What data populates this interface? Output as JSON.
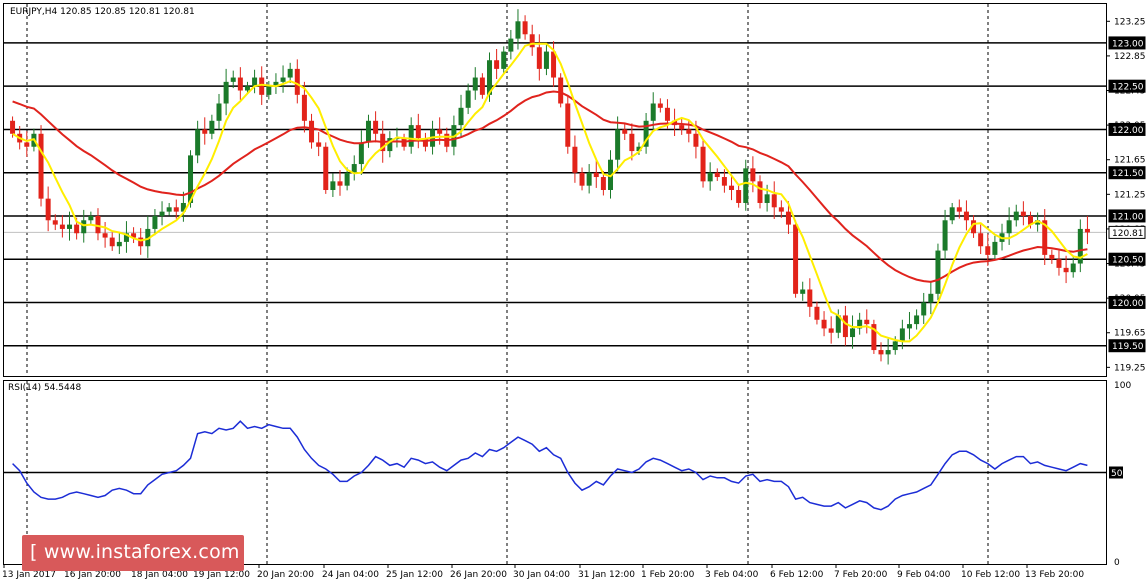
{
  "header": {
    "title": "EURJPY,H4  120.85 120.85 120.81 120.81"
  },
  "indicator": {
    "title": "RSI(14) 54.5448"
  },
  "watermark": {
    "text": "[ www.instaforex.com ]"
  },
  "colors": {
    "bull": "#1b7a2a",
    "bear": "#e2231a",
    "ma_fast": "#ffee00",
    "ma_slow": "#e0231d",
    "rsi": "#1c2dd6",
    "level_line": "#000000",
    "session_line": "#000000",
    "current_price": "#c0c0c0"
  },
  "chart_data": [
    {
      "type": "candlestick",
      "title": "EURJPY,H4  120.85 120.85 120.81 120.81",
      "ylim": [
        119.15,
        123.45
      ],
      "y_ticks": [
        "123.25",
        "122.85",
        "122.45",
        "122.05",
        "121.65",
        "121.25",
        "120.85",
        "120.45",
        "120.05",
        "119.65",
        "119.25"
      ],
      "level_labels": [
        "123.00",
        "122.50",
        "122.00",
        "121.50",
        "121.00",
        "120.81",
        "120.50",
        "120.00",
        "119.50"
      ],
      "levels": [
        123.0,
        122.5,
        122.0,
        121.5,
        121.0,
        120.5,
        120.0,
        119.5
      ],
      "current_price": 120.81,
      "x_labels": [
        "13 Jan 2017",
        "16 Jan 20:00",
        "18 Jan 04:00",
        "19 Jan 12:00",
        "20 Jan 20:00",
        "24 Jan 04:00",
        "25 Jan 12:00",
        "26 Jan 20:00",
        "30 Jan 04:00",
        "31 Jan 12:00",
        "1 Feb 20:00",
        "3 Feb 04:00",
        "6 Feb 12:00",
        "7 Feb 20:00",
        "9 Feb 04:00",
        "10 Feb 12:00",
        "13 Feb 20:00"
      ],
      "close": [
        121.95,
        121.85,
        121.8,
        121.95,
        121.2,
        120.95,
        120.9,
        120.85,
        120.9,
        120.8,
        120.95,
        121.0,
        120.8,
        120.75,
        120.65,
        120.7,
        120.8,
        120.75,
        120.65,
        120.85,
        121.0,
        121.05,
        121.1,
        121.05,
        121.15,
        121.7,
        122.0,
        121.95,
        122.1,
        122.3,
        122.55,
        122.6,
        122.45,
        122.5,
        122.6,
        122.4,
        122.5,
        122.55,
        122.6,
        122.7,
        122.4,
        122.1,
        121.85,
        121.8,
        121.3,
        121.4,
        121.35,
        121.5,
        121.6,
        121.85,
        122.1,
        121.95,
        121.75,
        121.9,
        121.9,
        121.8,
        122.05,
        121.9,
        121.8,
        122.0,
        121.95,
        121.8,
        122.05,
        122.25,
        122.45,
        122.6,
        122.4,
        122.8,
        122.7,
        122.9,
        123.05,
        123.25,
        123.1,
        122.95,
        122.7,
        122.9,
        122.6,
        122.3,
        121.8,
        121.5,
        121.35,
        121.5,
        121.45,
        121.3,
        121.65,
        122.0,
        121.95,
        121.75,
        121.8,
        122.1,
        122.3,
        122.25,
        122.1,
        122.05,
        122.0,
        121.95,
        121.8,
        121.4,
        121.5,
        121.45,
        121.35,
        121.3,
        121.15,
        121.55,
        121.4,
        121.15,
        121.25,
        121.1,
        121.05,
        120.9,
        120.1,
        120.15,
        119.95,
        119.8,
        119.7,
        119.65,
        119.85,
        119.6,
        119.7,
        119.8,
        119.75,
        119.45,
        119.4,
        119.45,
        119.55,
        119.7,
        119.75,
        119.85,
        120.0,
        120.1,
        120.6,
        120.95,
        121.1,
        121.05,
        120.95,
        120.8,
        120.65,
        120.55,
        120.7,
        120.8,
        120.95,
        121.05,
        121.0,
        120.9,
        120.95,
        120.55,
        120.5,
        120.4,
        120.35,
        120.45,
        120.85,
        120.81
      ]
    },
    {
      "type": "line",
      "title": "RSI(14) 54.5448",
      "ylim": [
        0,
        100
      ],
      "y_ticks": [
        "100",
        "50",
        "0"
      ],
      "reference_level": 50,
      "values": [
        55,
        51,
        44,
        39,
        36,
        35,
        35,
        36,
        38,
        39,
        38,
        37,
        36,
        37,
        40,
        41,
        40,
        38,
        38,
        43,
        46,
        49,
        50,
        51,
        54,
        58,
        72,
        73,
        72,
        75,
        74,
        75,
        79,
        75,
        76,
        75,
        77,
        76,
        75,
        75,
        70,
        63,
        58,
        54,
        52,
        49,
        45,
        45,
        48,
        50,
        54,
        59,
        57,
        54,
        55,
        53,
        58,
        57,
        55,
        56,
        53,
        51,
        54,
        57,
        58,
        61,
        59,
        63,
        62,
        64,
        67,
        70,
        68,
        66,
        62,
        64,
        60,
        58,
        50,
        44,
        40,
        42,
        45,
        43,
        48,
        52,
        51,
        50,
        52,
        56,
        58,
        57,
        55,
        53,
        51,
        52,
        50,
        46,
        48,
        47,
        47,
        45,
        44,
        48,
        49,
        45,
        46,
        45,
        45,
        42,
        35,
        36,
        33,
        32,
        31,
        31,
        33,
        30,
        32,
        34,
        33,
        30,
        29,
        31,
        35,
        37,
        38,
        39,
        41,
        43,
        49,
        55,
        60,
        62,
        62,
        60,
        57,
        55,
        52,
        55,
        57,
        59,
        59,
        55,
        56,
        54,
        53,
        52,
        51,
        53,
        55,
        54
      ]
    }
  ]
}
